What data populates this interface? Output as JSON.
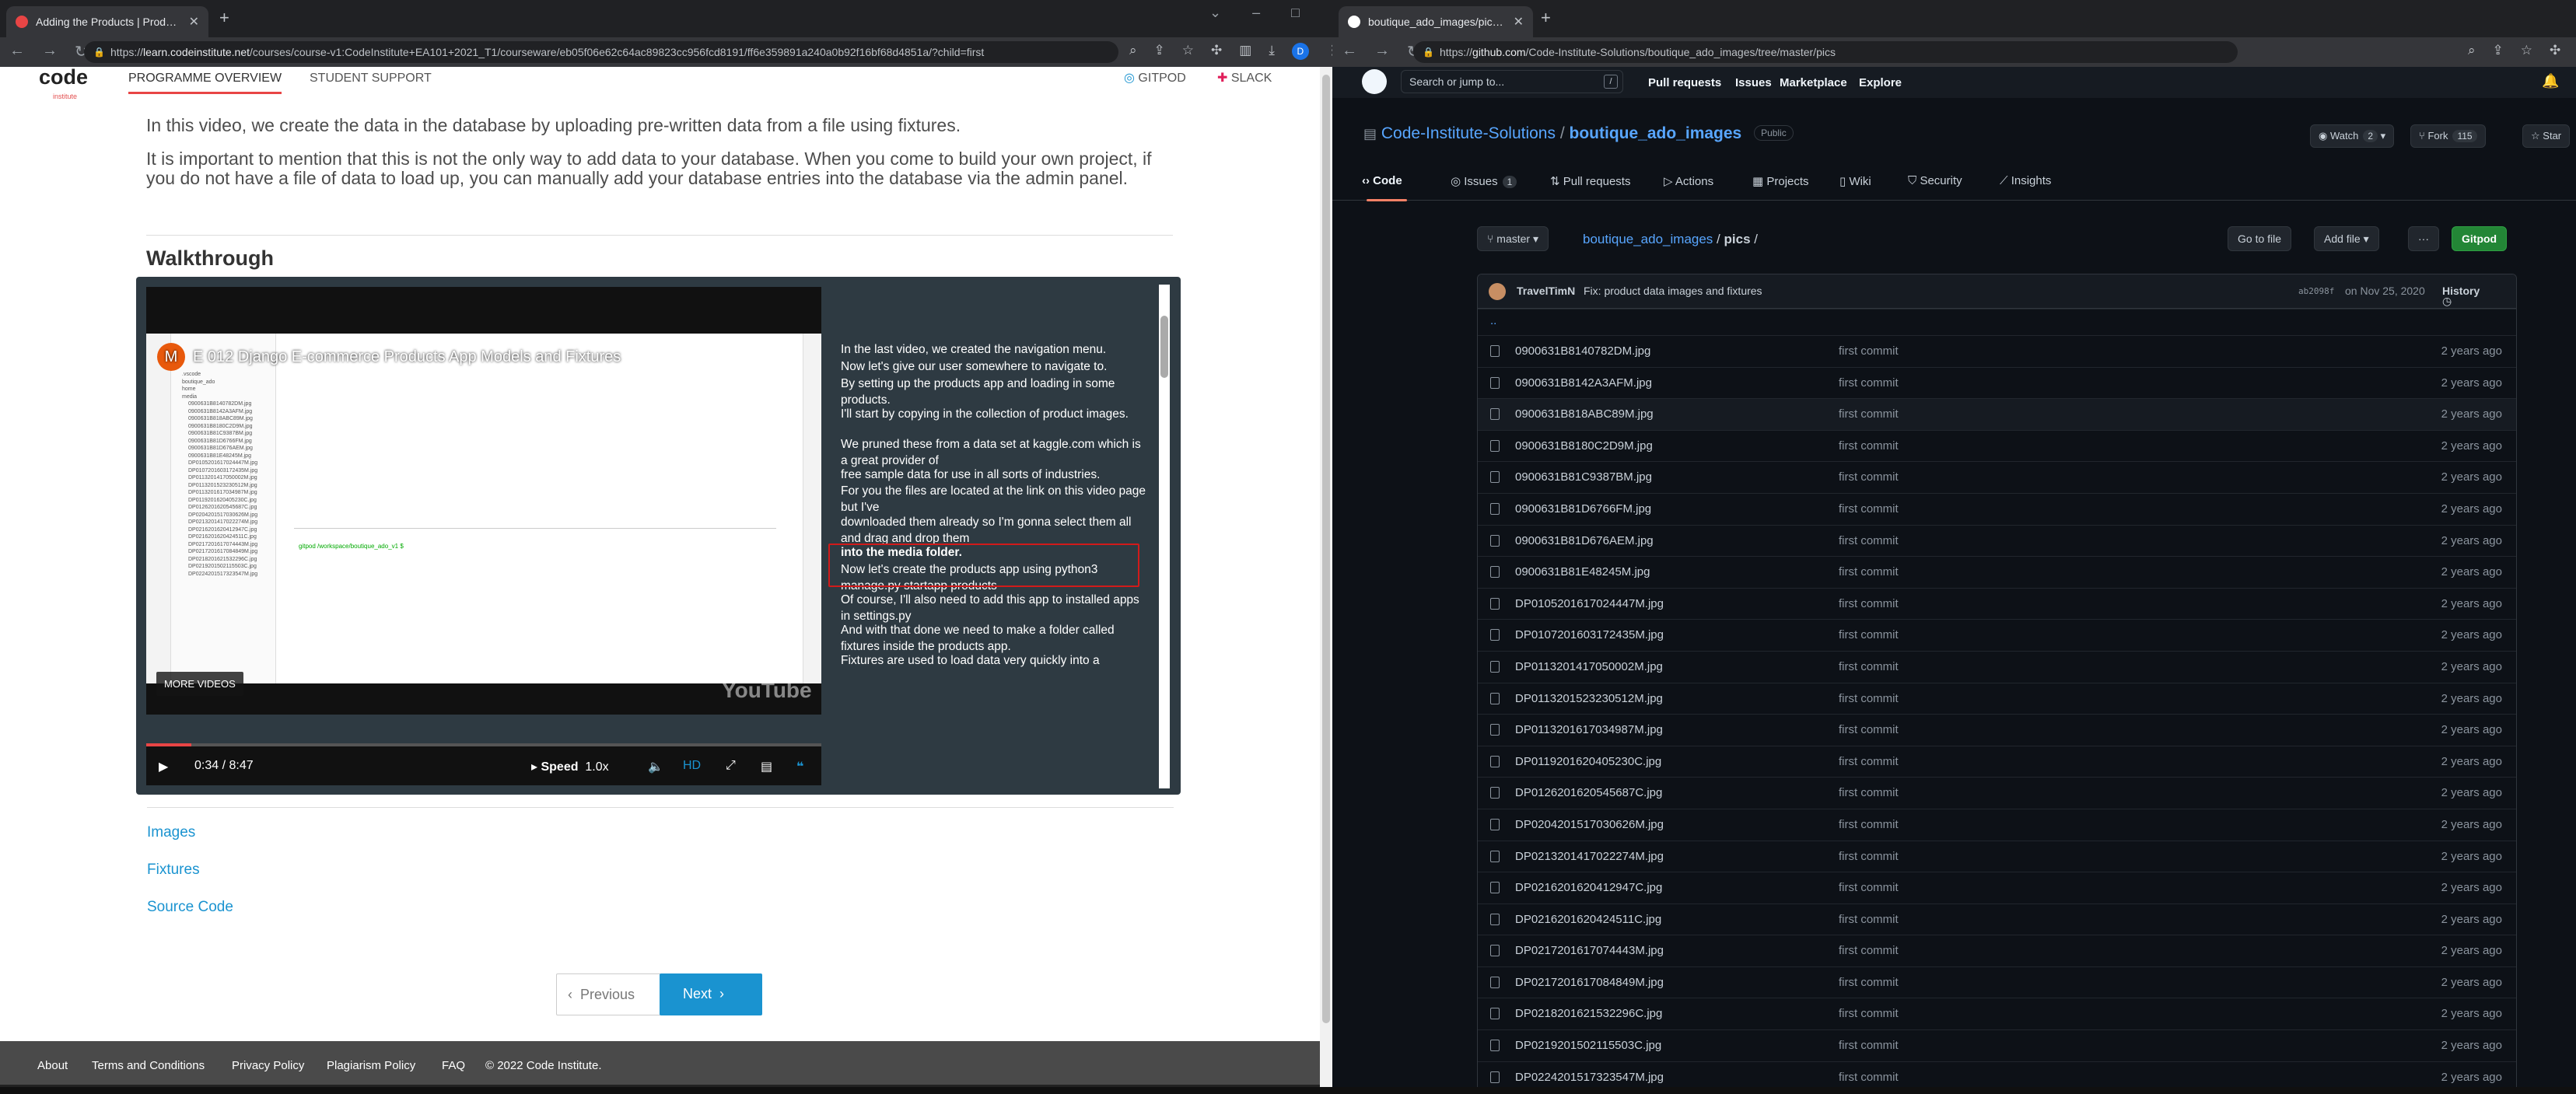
{
  "left_window": {
    "tab": {
      "title": "Adding the Products | Products Q..."
    },
    "url": {
      "host": "learn.codeinstitute.net",
      "path": "/courses/course-v1:CodeInstitute+EA101+2021_T1/courseware/eb05f06e62c64ac89823cc956fcd8191/ff6e359891a240a0b92f16bf68d4851a/?child=first",
      "scheme": "https://"
    },
    "profile_initial": "D",
    "header": {
      "logo_text": "code",
      "logo_sub": "institute",
      "programme_overview": "PROGRAMME OVERVIEW",
      "student_support": "STUDENT SUPPORT",
      "gitpod": "GITPOD",
      "slack": "SLACK"
    },
    "content": {
      "intro": "In this video, we create the data in the database by uploading pre-written data from a file using fixtures.",
      "note": "It is important to mention that this is not the only way to add data to your database. When you come to build your own project, if you do not have a file of data to load up, you can manually add your database entries into the database via the admin panel.",
      "walkthrough_heading": "Walkthrough"
    },
    "video": {
      "title": "E 012 Django E-commerce Products App Models and Fixtures",
      "avatar": "M",
      "more_videos": "MORE VIDEOS",
      "watermark": "YouTube",
      "time": "0:34 / 8:47",
      "speed_label": "Speed",
      "speed_value": "1.0x",
      "hd": "HD",
      "progress": 0.067,
      "transcript": [
        "In the last video, we created the navigation menu.",
        "Now let's give our user somewhere to navigate to.",
        "By setting up the products app and loading in some products.",
        "I'll start by copying in the collection of product images.",
        "We pruned these from a data set at kaggle.com which is a great provider of",
        "free sample data for use in all sorts of industries.",
        "For you the files are located at the link on this video page but I've",
        "downloaded them already so I'm gonna select them all and drag and drop them",
        "into the media folder.",
        "Now let's create the products app using python3 manage.py startapp products",
        "Of course, I'll also need to add this app to installed apps in settings.py",
        "And with that done we need to make a folder called fixtures inside the products app.",
        "Fixtures are used to load data very quickly into a"
      ],
      "ide_files": [
        "0900631B8140782DM.jpg",
        "0900631B8142A3AFM.jpg",
        "0900631B818ABC89M.jpg",
        "0900631B8180C2D9M.jpg",
        "0900631B81C9387BM.jpg",
        "0900631B81D6766FM.jpg",
        "0900631B81D676AEM.jpg",
        "0900631B81E48245M.jpg",
        "DP0105201617024447M.jpg",
        "DP0107201603172435M.jpg",
        "DP0113201417050002M.jpg",
        "DP0113201523230512M.jpg",
        "DP0113201617034987M.jpg",
        "DP0119201620405230C.jpg",
        "DP0126201620545687C.jpg",
        "DP0204201517030626M.jpg",
        "DP0213201417022274M.jpg",
        "DP0216201620412947C.jpg",
        "DP0216201620424511C.jpg",
        "DP0217201617074443M.jpg",
        "DP0217201617084849M.jpg",
        "DP0218201621532296C.jpg",
        "DP0219201502115503C.jpg",
        "DP0224201517323547M.jpg"
      ]
    },
    "links": {
      "images": "Images",
      "fixtures": "Fixtures",
      "source_code": "Source Code"
    },
    "pager": {
      "previous": "Previous",
      "next": "Next"
    },
    "footer": {
      "about": "About",
      "terms": "Terms and Conditions",
      "privacy": "Privacy Policy",
      "plagiarism": "Plagiarism Policy",
      "faq": "FAQ",
      "copyright": "© 2022 Code Institute."
    }
  },
  "right_window": {
    "tab": {
      "title": "boutique_ado_images/pics at m..."
    },
    "url": {
      "host": "github.com",
      "path": "/Code-Institute-Solutions/boutique_ado_images/tree/master/pics",
      "scheme": "https://"
    },
    "header": {
      "search_placeholder": "Search or jump to...",
      "slash": "/",
      "nav": [
        "Pull requests",
        "Issues",
        "Marketplace",
        "Explore"
      ]
    },
    "repo": {
      "owner": "Code-Institute-Solutions",
      "separator": "/",
      "name": "boutique_ado_images",
      "visibility": "Public",
      "watch": "Watch",
      "watch_count": "2",
      "fork": "Fork",
      "fork_count": "115",
      "star": "Star"
    },
    "tabs": [
      {
        "label": "Code"
      },
      {
        "label": "Issues",
        "count": "1"
      },
      {
        "label": "Pull requests"
      },
      {
        "label": "Actions"
      },
      {
        "label": "Projects"
      },
      {
        "label": "Wiki"
      },
      {
        "label": "Security"
      },
      {
        "label": "Insights"
      }
    ],
    "branch": "master",
    "breadcrumb": {
      "repo": "boutique_ado_images",
      "sep1": "/",
      "dir": "pics",
      "sep2": "/"
    },
    "buttons": {
      "go_to_file": "Go to file",
      "add_file": "Add file",
      "more": "···",
      "gitpod": "Gitpod"
    },
    "commit": {
      "author": "TravelTimN",
      "message": "Fix: product data images and fixtures",
      "sha": "ab2098f",
      "date": "on Nov 25, 2020",
      "history": "History"
    },
    "parent_dir": "..",
    "files": [
      {
        "name": "0900631B8140782DM.jpg",
        "message": "first commit",
        "age": "2 years ago"
      },
      {
        "name": "0900631B8142A3AFM.jpg",
        "message": "first commit",
        "age": "2 years ago"
      },
      {
        "name": "0900631B818ABC89M.jpg",
        "message": "first commit",
        "age": "2 years ago"
      },
      {
        "name": "0900631B8180C2D9M.jpg",
        "message": "first commit",
        "age": "2 years ago"
      },
      {
        "name": "0900631B81C9387BM.jpg",
        "message": "first commit",
        "age": "2 years ago"
      },
      {
        "name": "0900631B81D6766FM.jpg",
        "message": "first commit",
        "age": "2 years ago"
      },
      {
        "name": "0900631B81D676AEM.jpg",
        "message": "first commit",
        "age": "2 years ago"
      },
      {
        "name": "0900631B81E48245M.jpg",
        "message": "first commit",
        "age": "2 years ago"
      },
      {
        "name": "DP0105201617024447M.jpg",
        "message": "first commit",
        "age": "2 years ago"
      },
      {
        "name": "DP0107201603172435M.jpg",
        "message": "first commit",
        "age": "2 years ago"
      },
      {
        "name": "DP0113201417050002M.jpg",
        "message": "first commit",
        "age": "2 years ago"
      },
      {
        "name": "DP0113201523230512M.jpg",
        "message": "first commit",
        "age": "2 years ago"
      },
      {
        "name": "DP0113201617034987M.jpg",
        "message": "first commit",
        "age": "2 years ago"
      },
      {
        "name": "DP0119201620405230C.jpg",
        "message": "first commit",
        "age": "2 years ago"
      },
      {
        "name": "DP0126201620545687C.jpg",
        "message": "first commit",
        "age": "2 years ago"
      },
      {
        "name": "DP0204201517030626M.jpg",
        "message": "first commit",
        "age": "2 years ago"
      },
      {
        "name": "DP0213201417022274M.jpg",
        "message": "first commit",
        "age": "2 years ago"
      },
      {
        "name": "DP0216201620412947C.jpg",
        "message": "first commit",
        "age": "2 years ago"
      },
      {
        "name": "DP0216201620424511C.jpg",
        "message": "first commit",
        "age": "2 years ago"
      },
      {
        "name": "DP0217201617074443M.jpg",
        "message": "first commit",
        "age": "2 years ago"
      },
      {
        "name": "DP0217201617084849M.jpg",
        "message": "first commit",
        "age": "2 years ago"
      },
      {
        "name": "DP0218201621532296C.jpg",
        "message": "first commit",
        "age": "2 years ago"
      },
      {
        "name": "DP0219201502115503C.jpg",
        "message": "first commit",
        "age": "2 years ago"
      },
      {
        "name": "DP0224201517323547M.jpg",
        "message": "first commit",
        "age": "2 years ago"
      }
    ]
  },
  "colors": {
    "ci_accent": "#e84545",
    "ci_link": "#1a93d0",
    "gh_bg": "#0d1117",
    "gh_link": "#58a6ff",
    "gh_green": "#238636",
    "highlight_box": "#d21a1a"
  }
}
